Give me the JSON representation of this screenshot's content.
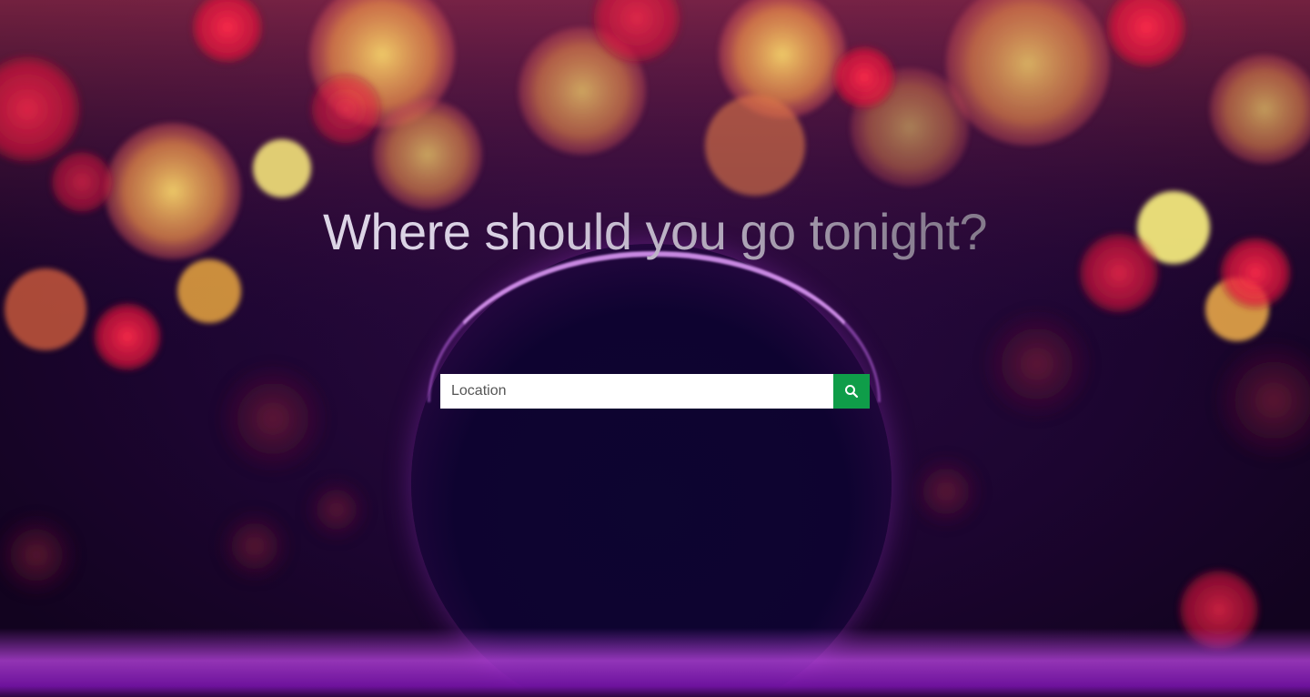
{
  "hero": {
    "headline": "Where should you go tonight?"
  },
  "search": {
    "placeholder": "Location",
    "value": "",
    "button_icon": "search-icon"
  },
  "colors": {
    "button_green": "#0f9d49",
    "background_purple": "#1c0530"
  }
}
